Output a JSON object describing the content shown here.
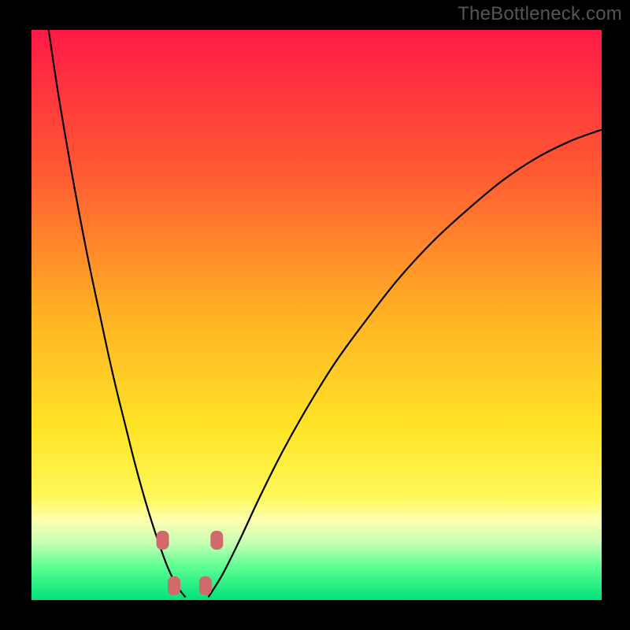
{
  "watermark": "TheBottleneck.com",
  "chart_data": {
    "type": "line",
    "title": "",
    "xlabel": "",
    "ylabel": "",
    "x_range": [
      0,
      100
    ],
    "y_range": [
      0,
      100
    ],
    "background_gradient": {
      "stops": [
        {
          "pos": 0.0,
          "color": "#ff1a47"
        },
        {
          "pos": 0.25,
          "color": "#ff5a32"
        },
        {
          "pos": 0.5,
          "color": "#ffb224"
        },
        {
          "pos": 0.7,
          "color": "#ffe427"
        },
        {
          "pos": 0.82,
          "color": "#fff85a"
        },
        {
          "pos": 0.86,
          "color": "#fcffb0"
        },
        {
          "pos": 0.9,
          "color": "#c7ffb3"
        },
        {
          "pos": 0.94,
          "color": "#5fff93"
        },
        {
          "pos": 1.0,
          "color": "#00e27a"
        }
      ]
    },
    "series": [
      {
        "name": "left-curve",
        "color": "#000000",
        "x": [
          3.0,
          4.5,
          6.0,
          7.5,
          9.0,
          10.5,
          12.0,
          13.5,
          15.0,
          16.5,
          18.0,
          19.5,
          21.0,
          22.5,
          24.0,
          25.5,
          27.0
        ],
        "y": [
          100,
          90,
          81,
          72.5,
          64.5,
          57,
          50,
          43,
          36.5,
          30.5,
          24.5,
          19,
          14,
          9.5,
          5.5,
          2.5,
          0.5
        ]
      },
      {
        "name": "right-curve",
        "color": "#000000",
        "x": [
          31.0,
          33.5,
          36.5,
          40.0,
          44.0,
          48.5,
          53.5,
          59.0,
          64.5,
          70.5,
          76.5,
          82.5,
          88.5,
          94.5,
          100.0
        ],
        "y": [
          0.5,
          4.5,
          10.5,
          18.0,
          26.0,
          34.0,
          42.0,
          49.5,
          56.5,
          63.0,
          68.5,
          73.5,
          77.5,
          80.5,
          82.5
        ]
      }
    ],
    "floor_markers": {
      "color": "#d16a6a",
      "points": [
        {
          "x": 23.0,
          "y": 10.5
        },
        {
          "x": 32.5,
          "y": 10.5
        },
        {
          "x": 25.0,
          "y": 2.5
        },
        {
          "x": 30.5,
          "y": 2.5
        }
      ]
    }
  }
}
